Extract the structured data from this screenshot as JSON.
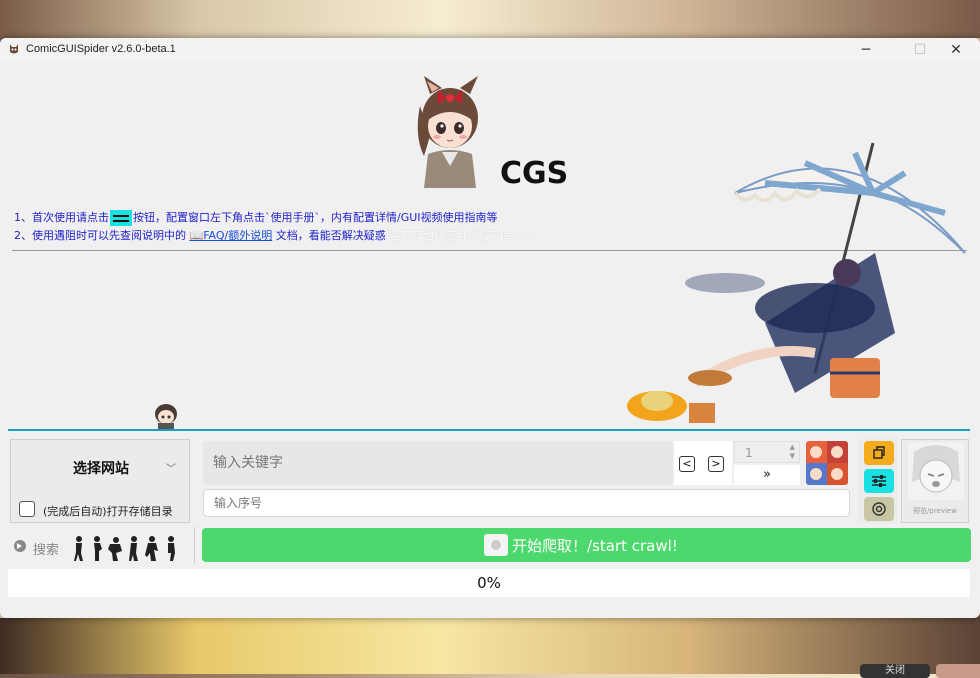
{
  "window": {
    "title": "ComicGUISpider v2.6.0-beta.1",
    "controls": {
      "minimize": "─",
      "maximize": "☐",
      "close": "✕"
    }
  },
  "logo": {
    "text": "CGS"
  },
  "guide": {
    "line1_prefix": "1、首次使用请点击",
    "line1_suffix": "按钮，配置窗口左下角点击`使用手册`，内有配置详情/GUI视频使用指南等",
    "line2_prefix": "2、使用遇阻时可以先查阅说明中的 ",
    "line2_link": "📖FAQ/额外说明",
    "line2_suffix": " 文档，看能否解决疑惑",
    "line2_faded": "(若有其他疑惑可以提交issue)"
  },
  "site_selector": {
    "label": "选择网站",
    "chevron": "﹀"
  },
  "auto_open": {
    "label": "(完成后自动)打开存储目录",
    "checked": false
  },
  "keyword_input": {
    "placeholder": "输入关键字",
    "value": ""
  },
  "pager": {
    "prev": "<",
    "next": ">",
    "page_value": "1",
    "jump_label": "»"
  },
  "index_input": {
    "placeholder": "输入序号",
    "value": ""
  },
  "tool_buttons": [
    {
      "name": "copy-icon",
      "color": "#f4ac1c"
    },
    {
      "name": "settings-icon",
      "color": "#19e1e1"
    },
    {
      "name": "refresh-icon",
      "color": "#c8c6a4"
    }
  ],
  "preview": {
    "label": "预览/preview"
  },
  "search": {
    "label": "搜索"
  },
  "start_button": {
    "label": "开始爬取！/start crawl!",
    "color": "#4cd86c"
  },
  "progress": {
    "value": 0,
    "text": "0%"
  },
  "backdrop_button": {
    "label": "关闭"
  }
}
